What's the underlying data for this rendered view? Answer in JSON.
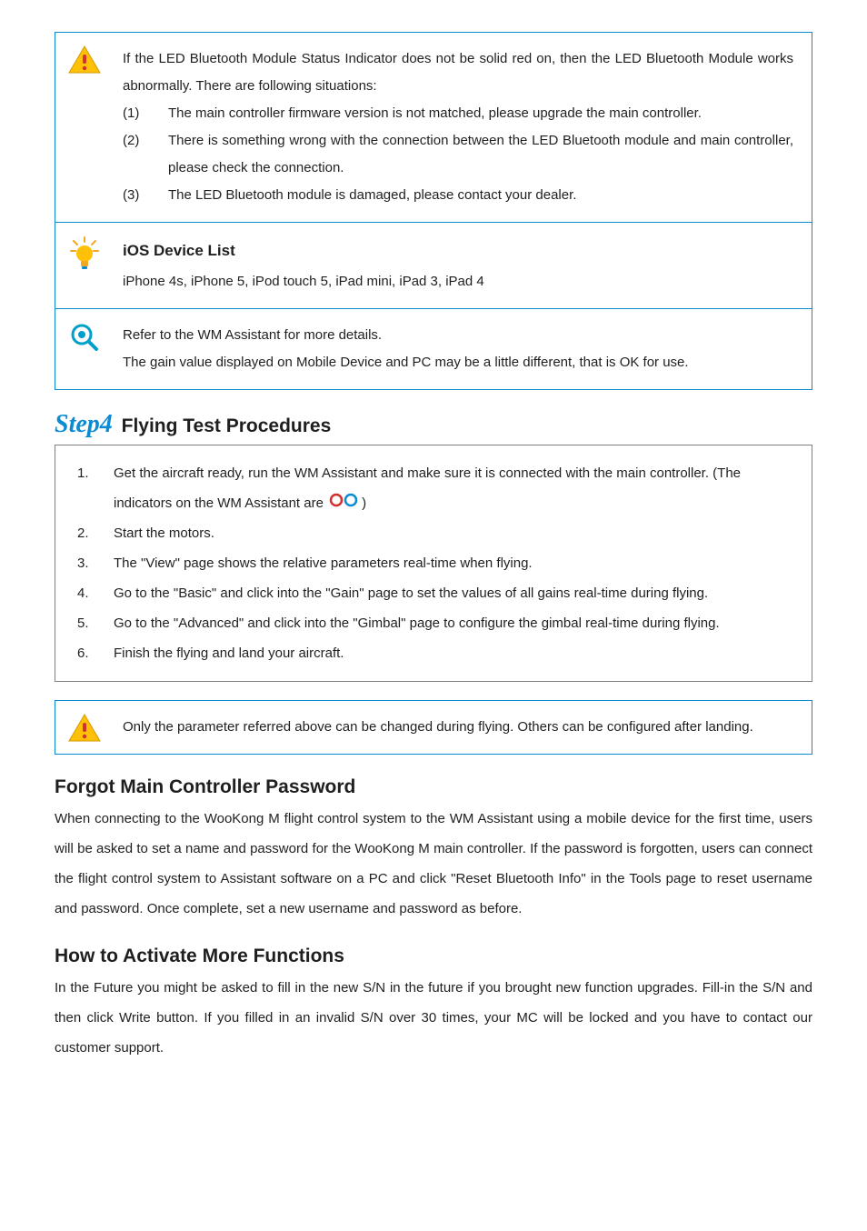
{
  "panel1": {
    "intro": "If the LED Bluetooth Module Status Indicator does not be solid red on, then the LED Bluetooth Module works abnormally. There are following situations:",
    "items": [
      {
        "num": "(1)",
        "text": "The main controller firmware version is not matched, please upgrade the main controller."
      },
      {
        "num": "(2)",
        "text": "There is something wrong with the connection between the LED Bluetooth module and main controller, please check the connection."
      },
      {
        "num": "(3)",
        "text": "The LED Bluetooth module is damaged, please contact your dealer."
      }
    ],
    "ios_heading": "iOS Device List",
    "ios_devices": "iPhone 4s, iPhone 5, iPod touch 5, iPad mini, iPad 3, iPad 4",
    "ref_line1": "Refer to the WM Assistant for more details.",
    "ref_line2": "The gain value displayed on Mobile Device and PC may be a little different, that is OK for use."
  },
  "step4": {
    "step_label": "Step4",
    "title_rest": " Flying Test Procedures",
    "items_pre1": "Get the aircraft ready, run the WM Assistant and make sure it is connected with the main controller. (The indicators on the WM Assistant are ",
    "items_post1": ")",
    "items": [
      {
        "num": "1.",
        "text": ""
      },
      {
        "num": "2.",
        "text": "Start the motors."
      },
      {
        "num": "3.",
        "text": "The \"View\" page shows the relative parameters real-time when flying."
      },
      {
        "num": "4.",
        "text": "Go to the \"Basic\" and click into the \"Gain\" page to set the values of all gains real-time during flying."
      },
      {
        "num": "5.",
        "text": "Go to the \"Advanced\" and click into the \"Gimbal\" page to configure the gimbal real-time during flying."
      },
      {
        "num": "6.",
        "text": "Finish the flying and land your aircraft."
      }
    ]
  },
  "note2": "Only the parameter referred above can be changed during flying. Others can be configured after landing.",
  "forgot": {
    "heading": "Forgot Main Controller Password",
    "body": "When connecting to the WooKong M flight control system to the WM Assistant using a mobile device for the first time, users will be asked to set a name and password for the WooKong M main controller. If the password is forgotten, users can connect the flight control system to Assistant software on a PC and click \"Reset Bluetooth Info\" in the Tools page to reset username and password. Once complete, set a new username and password as before."
  },
  "activate": {
    "heading": "How to Activate More Functions",
    "body": "In the Future you might be asked to fill in the new S/N in the future if you brought new function upgrades. Fill-in the S/N and then click Write button. If you filled in an invalid S/N over 30 times, your MC will be locked and you have to contact our customer support."
  }
}
